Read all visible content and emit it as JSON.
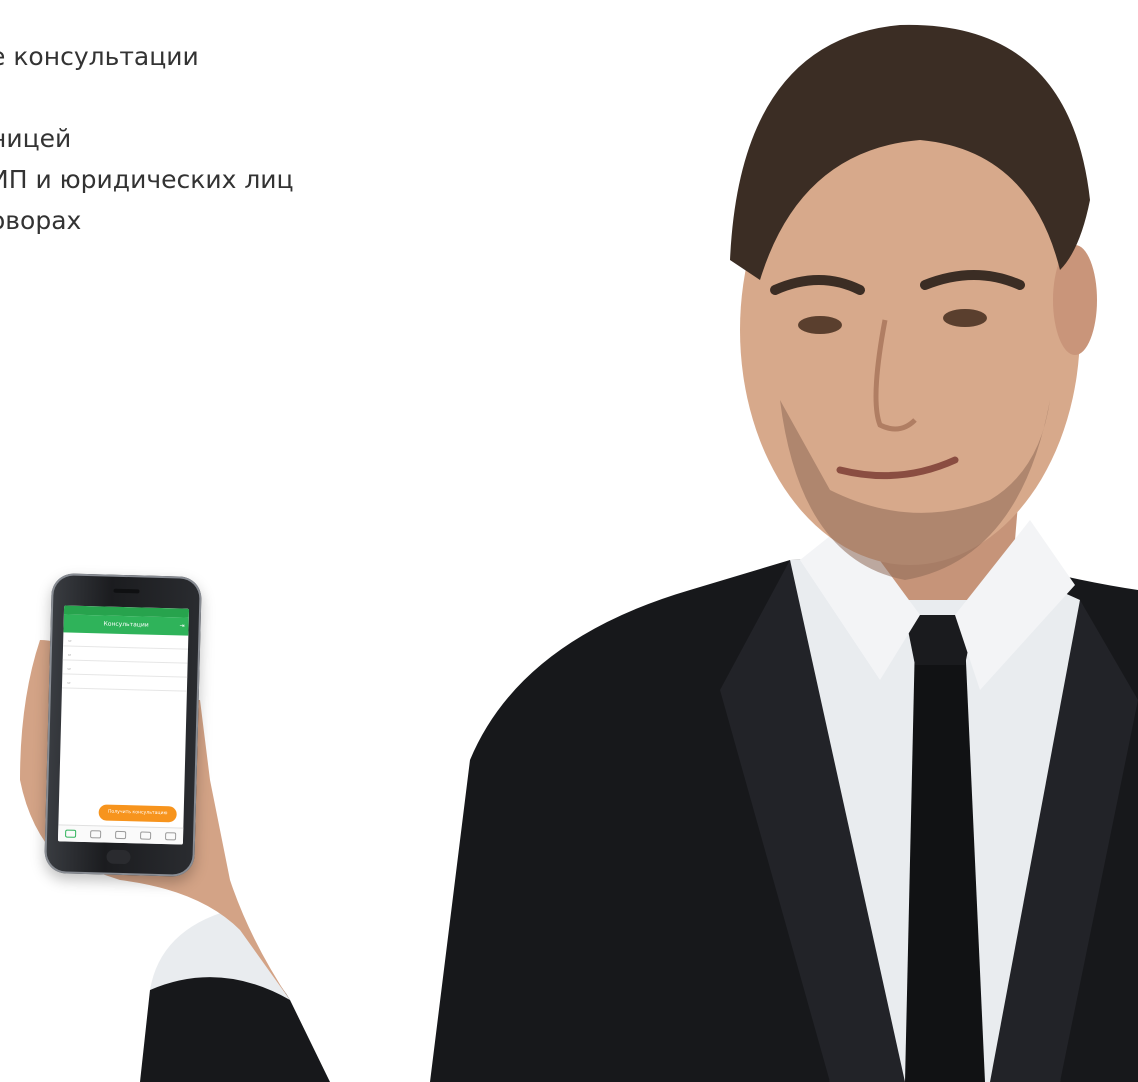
{
  "features": {
    "items": [
      "е консультации",
      "",
      "ницей",
      " ИП и юридических лиц",
      "оворах"
    ]
  },
  "phone": {
    "status": {
      "carrier": "",
      "time": "",
      "battery": ""
    },
    "app_title": "Консультации",
    "cards": [
      {
        "tag": "",
        "tag_color": "#2fb35a",
        "title": "",
        "meta_left": "",
        "meta_right": ""
      },
      {
        "tag": "",
        "tag_color": "#e2453c",
        "title": "",
        "meta_left": "",
        "meta_right": ""
      },
      {
        "tag": "",
        "tag_color": "#e2453c",
        "title": "",
        "meta_left": "",
        "meta_right": ""
      },
      {
        "tag": "",
        "tag_color": "#2fb35a",
        "title": "",
        "meta_left": "",
        "meta_right": ""
      }
    ],
    "cta_label": "Получить консультацию"
  },
  "colors": {
    "brand_green": "#2fb35a",
    "cta_orange": "#f7941d",
    "alert_red": "#e2453c",
    "text": "#333333"
  }
}
